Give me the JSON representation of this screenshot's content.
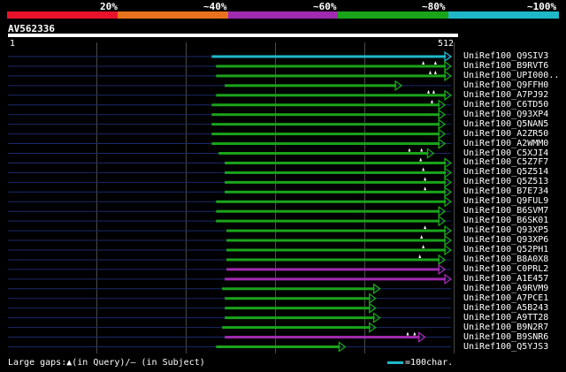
{
  "legend": {
    "labels": [
      "20%",
      "~40%",
      "~60%",
      "~80%",
      "~100%"
    ],
    "colors": [
      "#e8132a",
      "#e8731c",
      "#a02ab0",
      "#1aa41a",
      "#1fb8c9"
    ]
  },
  "query": {
    "title": "AV562336",
    "start_label": "1",
    "end_label": "512",
    "length": 512
  },
  "hits": [
    {
      "label": "UniRef100_Q9SIV3",
      "start": 236,
      "end": 512,
      "color": "#1fb8c9",
      "marks": []
    },
    {
      "label": "UniRef100_B9RVT6",
      "start": 241,
      "end": 512,
      "color": "#1aa41a",
      "marks": [
        480,
        494
      ]
    },
    {
      "label": "UniRef100_UPI000..",
      "start": 241,
      "end": 512,
      "color": "#1aa41a",
      "marks": [
        488,
        494
      ]
    },
    {
      "label": "UniRef100_Q9FFH0",
      "start": 251,
      "end": 455,
      "color": "#1aa41a",
      "marks": []
    },
    {
      "label": "UniRef100_A7PJ92",
      "start": 241,
      "end": 512,
      "color": "#1aa41a",
      "marks": [
        486,
        492
      ]
    },
    {
      "label": "UniRef100_C6TD50",
      "start": 236,
      "end": 505,
      "color": "#1aa41a",
      "marks": [
        490
      ]
    },
    {
      "label": "UniRef100_Q93XP4",
      "start": 236,
      "end": 505,
      "color": "#1aa41a",
      "marks": []
    },
    {
      "label": "UniRef100_Q5NAN5",
      "start": 236,
      "end": 505,
      "color": "#1aa41a",
      "marks": []
    },
    {
      "label": "UniRef100_A2ZR50",
      "start": 236,
      "end": 505,
      "color": "#1aa41a",
      "marks": []
    },
    {
      "label": "UniRef100_A2WMM0",
      "start": 236,
      "end": 505,
      "color": "#1aa41a",
      "marks": []
    },
    {
      "label": "UniRef100_C5XJI4",
      "start": 244,
      "end": 492,
      "color": "#1aa41a",
      "marks": [
        464,
        478
      ]
    },
    {
      "label": "UniRef100_C5Z7F7",
      "start": 251,
      "end": 512,
      "color": "#1aa41a",
      "marks": [
        477
      ]
    },
    {
      "label": "UniRef100_Q5Z514",
      "start": 251,
      "end": 512,
      "color": "#1aa41a",
      "marks": [
        480
      ]
    },
    {
      "label": "UniRef100_Q5Z513",
      "start": 251,
      "end": 512,
      "color": "#1aa41a",
      "marks": [
        482
      ]
    },
    {
      "label": "UniRef100_B7E734",
      "start": 251,
      "end": 512,
      "color": "#1aa41a",
      "marks": [
        482
      ]
    },
    {
      "label": "UniRef100_Q9FUL9",
      "start": 241,
      "end": 512,
      "color": "#1aa41a",
      "marks": []
    },
    {
      "label": "UniRef100_B6SVM7",
      "start": 241,
      "end": 505,
      "color": "#1aa41a",
      "marks": []
    },
    {
      "label": "UniRef100_B6SK01",
      "start": 241,
      "end": 505,
      "color": "#1aa41a",
      "marks": []
    },
    {
      "label": "UniRef100_Q93XP5",
      "start": 253,
      "end": 512,
      "color": "#1aa41a",
      "marks": [
        482
      ]
    },
    {
      "label": "UniRef100_Q93XP6",
      "start": 253,
      "end": 512,
      "color": "#1aa41a",
      "marks": [
        478
      ]
    },
    {
      "label": "UniRef100_Q52PH1",
      "start": 253,
      "end": 512,
      "color": "#1aa41a",
      "marks": [
        480
      ]
    },
    {
      "label": "UniRef100_B8A0X8",
      "start": 253,
      "end": 505,
      "color": "#1aa41a",
      "marks": [
        476
      ]
    },
    {
      "label": "UniRef100_C0PRL2",
      "start": 253,
      "end": 505,
      "color": "#a02ab0",
      "marks": []
    },
    {
      "label": "UniRef100_A1E457",
      "start": 251,
      "end": 512,
      "color": "#a02ab0",
      "marks": []
    },
    {
      "label": "UniRef100_A9RVM9",
      "start": 248,
      "end": 430,
      "color": "#1aa41a",
      "marks": []
    },
    {
      "label": "UniRef100_A7PCE1",
      "start": 251,
      "end": 425,
      "color": "#1aa41a",
      "marks": []
    },
    {
      "label": "UniRef100_A5B243",
      "start": 251,
      "end": 425,
      "color": "#1aa41a",
      "marks": []
    },
    {
      "label": "UniRef100_A9TT28",
      "start": 251,
      "end": 430,
      "color": "#1aa41a",
      "marks": []
    },
    {
      "label": "UniRef100_B9N2R7",
      "start": 248,
      "end": 425,
      "color": "#1aa41a",
      "marks": []
    },
    {
      "label": "UniRef100_B9SNR6",
      "start": 251,
      "end": 482,
      "color": "#a02ab0",
      "marks": [
        462,
        470
      ]
    },
    {
      "label": "UniRef100_Q5YJS3",
      "start": 241,
      "end": 390,
      "color": "#1aa41a",
      "marks": []
    }
  ],
  "footer": {
    "gaps_text": "Large gaps:▲(in Query)/– (in Subject)",
    "scale_text": "=100char.",
    "scale_color": "#1fb8c9"
  }
}
